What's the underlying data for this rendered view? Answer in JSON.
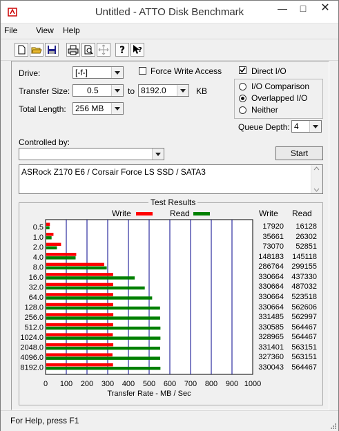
{
  "window": {
    "title": "Untitled - ATTO Disk Benchmark"
  },
  "menu": [
    "File",
    "View",
    "Help"
  ],
  "form": {
    "drive_label": "Drive:",
    "drive_value": "[-f-]",
    "force_write_label": "Force Write Access",
    "direct_io_label": "Direct I/O",
    "transfer_size_label": "Transfer Size:",
    "transfer_from": "0.5",
    "to_label": "to",
    "transfer_to": "8192.0",
    "kb_label": "KB",
    "total_length_label": "Total Length:",
    "total_length_value": "256 MB",
    "io_comparison_label": "I/O Comparison",
    "overlapped_io_label": "Overlapped I/O",
    "neither_label": "Neither",
    "queue_depth_label": "Queue Depth:",
    "queue_depth_value": "4",
    "controlled_by_label": "Controlled by:",
    "controlled_by_value": "",
    "start_label": "Start",
    "description": "ASRock Z170 E6 / Corsair Force LS SSD / SATA3",
    "direct_io_checked": true,
    "force_write_checked": false,
    "selected_mode": "Overlapped I/O"
  },
  "chart_data": {
    "type": "bar",
    "title": "Test Results",
    "xlabel": "Transfer Rate - MB / Sec",
    "xlim": [
      0,
      1000
    ],
    "xticks": [
      "0",
      "100",
      "200",
      "300",
      "400",
      "500",
      "600",
      "700",
      "800",
      "900",
      "1000"
    ],
    "legend_write": "Write",
    "legend_read": "Read",
    "col_write": "Write",
    "col_read": "Read",
    "write_color": "#ff0000",
    "read_color": "#008000",
    "categories": [
      "0.5",
      "1.0",
      "2.0",
      "4.0",
      "8.0",
      "16.0",
      "32.0",
      "64.0",
      "128.0",
      "256.0",
      "512.0",
      "1024.0",
      "2048.0",
      "4096.0",
      "8192.0"
    ],
    "write_kb": [
      17920,
      35661,
      73070,
      148183,
      286764,
      330664,
      330664,
      330664,
      330664,
      331485,
      330585,
      328965,
      331401,
      327360,
      330043
    ],
    "read_kb": [
      16128,
      26302,
      52851,
      145118,
      299155,
      437330,
      487032,
      523518,
      562606,
      562997,
      564467,
      564467,
      563151,
      563151,
      564467
    ],
    "series": [
      {
        "name": "Write",
        "values": [
          17.5,
          34.8,
          71.4,
          144.7,
          280.0,
          322.9,
          322.9,
          322.9,
          322.9,
          323.7,
          322.8,
          321.3,
          323.6,
          319.7,
          322.3
        ]
      },
      {
        "name": "Read",
        "values": [
          15.8,
          25.7,
          51.6,
          141.7,
          292.1,
          427.1,
          475.6,
          511.2,
          549.4,
          549.8,
          551.2,
          551.2,
          549.9,
          549.9,
          551.2
        ]
      }
    ]
  },
  "status": {
    "text": "For Help, press F1"
  }
}
